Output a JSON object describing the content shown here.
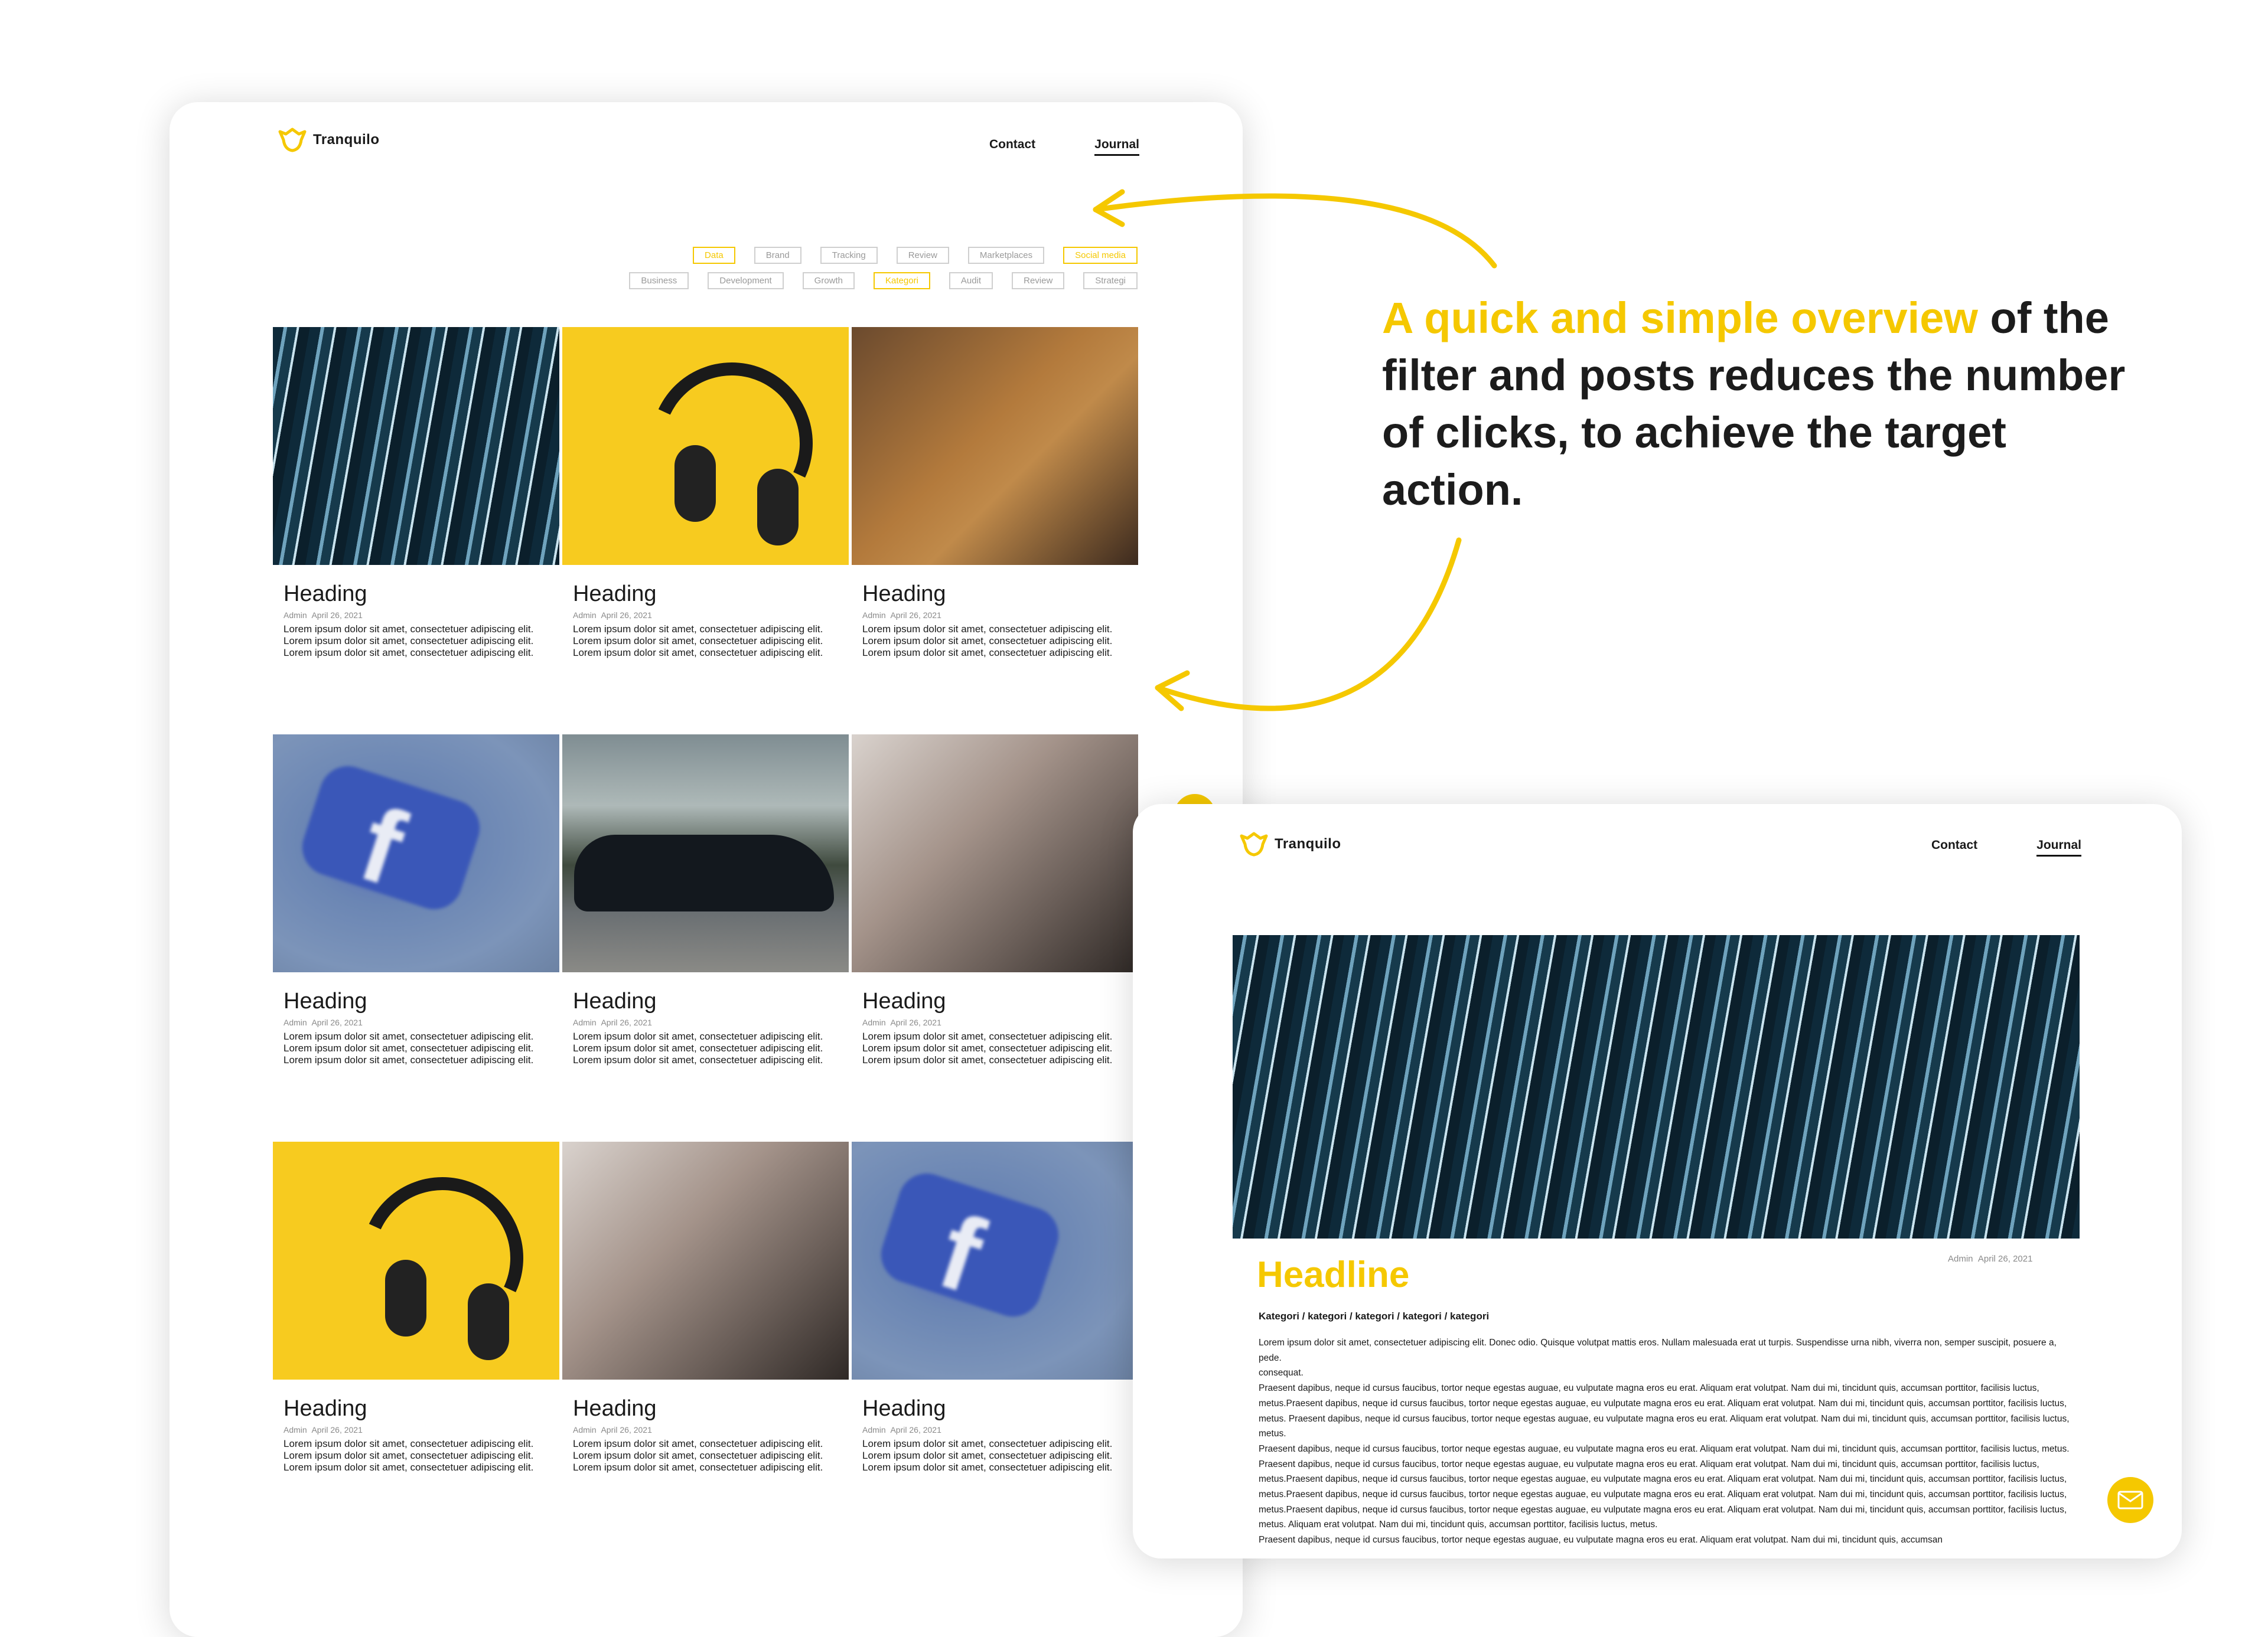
{
  "brand": {
    "name": "Tranquilo",
    "accent": "#f5c800"
  },
  "nav": {
    "contact": "Contact",
    "journal": "Journal"
  },
  "filters": {
    "row1": [
      {
        "label": "Data",
        "selected": true
      },
      {
        "label": "Brand",
        "selected": false
      },
      {
        "label": "Tracking",
        "selected": false
      },
      {
        "label": "Review",
        "selected": false
      },
      {
        "label": "Marketplaces",
        "selected": false
      },
      {
        "label": "Social media",
        "selected": true
      }
    ],
    "row2": [
      {
        "label": "Business",
        "selected": false
      },
      {
        "label": "Development",
        "selected": false
      },
      {
        "label": "Growth",
        "selected": false
      },
      {
        "label": "Kategori",
        "selected": true
      },
      {
        "label": "Audit",
        "selected": false
      },
      {
        "label": "Review",
        "selected": false
      },
      {
        "label": "Strategi",
        "selected": false
      }
    ]
  },
  "posts": [
    {
      "heading": "Heading",
      "author": "Admin",
      "date": "April 26, 2021",
      "image": "light-streaks",
      "excerpt": "Lorem ipsum dolor sit amet, consectetuer adipiscing elit. Lorem ipsum dolor sit amet, consectetuer adipiscing elit. Lorem ipsum dolor sit amet, consectetuer adipiscing elit."
    },
    {
      "heading": "Heading",
      "author": "Admin",
      "date": "April 26, 2021",
      "image": "headphones",
      "excerpt": "Lorem ipsum dolor sit amet, consectetuer adipiscing elit. Lorem ipsum dolor sit amet, consectetuer adipiscing elit. Lorem ipsum dolor sit amet, consectetuer adipiscing elit."
    },
    {
      "heading": "Heading",
      "author": "Admin",
      "date": "April 26, 2021",
      "image": "laptop",
      "excerpt": "Lorem ipsum dolor sit amet, consectetuer adipiscing elit. Lorem ipsum dolor sit amet, consectetuer adipiscing elit. Lorem ipsum dolor sit amet, consectetuer adipiscing elit."
    },
    {
      "heading": "Heading",
      "author": "Admin",
      "date": "April 26, 2021",
      "image": "facebook",
      "excerpt": "Lorem ipsum dolor sit amet, consectetuer adipiscing elit. Lorem ipsum dolor sit amet, consectetuer adipiscing elit. Lorem ipsum dolor sit amet, consectetuer adipiscing elit."
    },
    {
      "heading": "Heading",
      "author": "Admin",
      "date": "April 26, 2021",
      "image": "car",
      "excerpt": "Lorem ipsum dolor sit amet, consectetuer adipiscing elit. Lorem ipsum dolor sit amet, consectetuer adipiscing elit. Lorem ipsum dolor sit amet, consectetuer adipiscing elit."
    },
    {
      "heading": "Heading",
      "author": "Admin",
      "date": "April 26, 2021",
      "image": "architecture",
      "excerpt": "Lorem ipsum dolor sit amet, consectetuer adipiscing elit. Lorem ipsum dolor sit amet, consectetuer adipiscing elit. Lorem ipsum dolor sit amet, consectetuer adipiscing elit."
    },
    {
      "heading": "Heading",
      "author": "Admin",
      "date": "April 26, 2021",
      "image": "headphones",
      "excerpt": "Lorem ipsum dolor sit amet, consectetuer adipiscing elit. Lorem ipsum dolor sit amet, consectetuer adipiscing elit. Lorem ipsum dolor sit amet, consectetuer adipiscing elit."
    },
    {
      "heading": "Heading",
      "author": "Admin",
      "date": "April 26, 2021",
      "image": "architecture",
      "excerpt": "Lorem ipsum dolor sit amet, consectetuer adipiscing elit. Lorem ipsum dolor sit amet, consectetuer adipiscing elit. Lorem ipsum dolor sit amet, consectetuer adipiscing elit."
    },
    {
      "heading": "Heading",
      "author": "Admin",
      "date": "April 26, 2021",
      "image": "facebook",
      "excerpt": "Lorem ipsum dolor sit amet, consectetuer adipiscing elit. Lorem ipsum dolor sit amet, consectetuer adipiscing elit. Lorem ipsum dolor sit amet, consectetuer adipiscing elit."
    }
  ],
  "callout": {
    "highlight": "A quick and simple overview",
    "rest": " of the filter and posts reduces the number of clicks, to achieve the target action."
  },
  "article": {
    "headline": "Headline",
    "author": "Admin",
    "date": "April 26, 2021",
    "categories": "Kategori / kategori / kategori / kategori / kategori",
    "paragraphs": [
      "Lorem ipsum dolor sit amet, consectetuer adipiscing elit. Donec odio. Quisque volutpat mattis eros. Nullam malesuada erat ut turpis. Suspendisse urna nibh, viverra non, semper suscipit, posuere a, pede.",
      "consequat.",
      "Praesent dapibus, neque id cursus faucibus, tortor neque egestas auguae, eu vulputate magna eros eu erat. Aliquam erat volutpat. Nam dui mi, tincidunt quis, accumsan porttitor, facilisis luctus, metus.Praesent dapibus, neque id cursus faucibus, tortor neque egestas auguae, eu vulputate magna eros eu erat. Aliquam erat volutpat. Nam dui mi, tincidunt quis, accumsan porttitor, facilisis luctus, metus. Praesent dapibus, neque id cursus faucibus, tortor neque egestas auguae, eu vulputate magna eros eu erat. Aliquam erat volutpat. Nam dui mi, tincidunt quis, accumsan porttitor, facilisis luctus, metus.",
      "Praesent dapibus, neque id cursus faucibus, tortor neque egestas auguae, eu vulputate magna eros eu erat. Aliquam erat volutpat. Nam dui mi, tincidunt quis, accumsan porttitor, facilisis luctus, metus.",
      "Praesent dapibus, neque id cursus faucibus, tortor neque egestas auguae, eu vulputate magna eros eu erat. Aliquam erat volutpat. Nam dui mi, tincidunt quis, accumsan porttitor, facilisis luctus, metus.Praesent dapibus, neque id cursus faucibus, tortor neque egestas auguae, eu vulputate magna eros eu erat. Aliquam erat volutpat. Nam dui mi, tincidunt quis, accumsan porttitor, facilisis luctus, metus.Praesent dapibus, neque id cursus faucibus, tortor neque egestas auguae, eu vulputate magna eros eu erat. Aliquam erat volutpat. Nam dui mi, tincidunt quis, accumsan porttitor, facilisis luctus, metus.Praesent dapibus, neque id cursus faucibus, tortor neque egestas auguae, eu vulputate magna eros eu erat. Aliquam erat volutpat. Nam dui mi, tincidunt quis, accumsan porttitor, facilisis luctus, metus. Aliquam erat volutpat. Nam dui mi, tincidunt quis, accumsan porttitor, facilisis luctus, metus.",
      "Praesent dapibus, neque id cursus faucibus, tortor neque egestas auguae, eu vulputate magna eros eu erat. Aliquam erat volutpat. Nam dui mi, tincidunt quis, accumsan"
    ]
  },
  "icons": {
    "mail": "mail-icon",
    "logo": "tranquilo-logo-icon"
  }
}
